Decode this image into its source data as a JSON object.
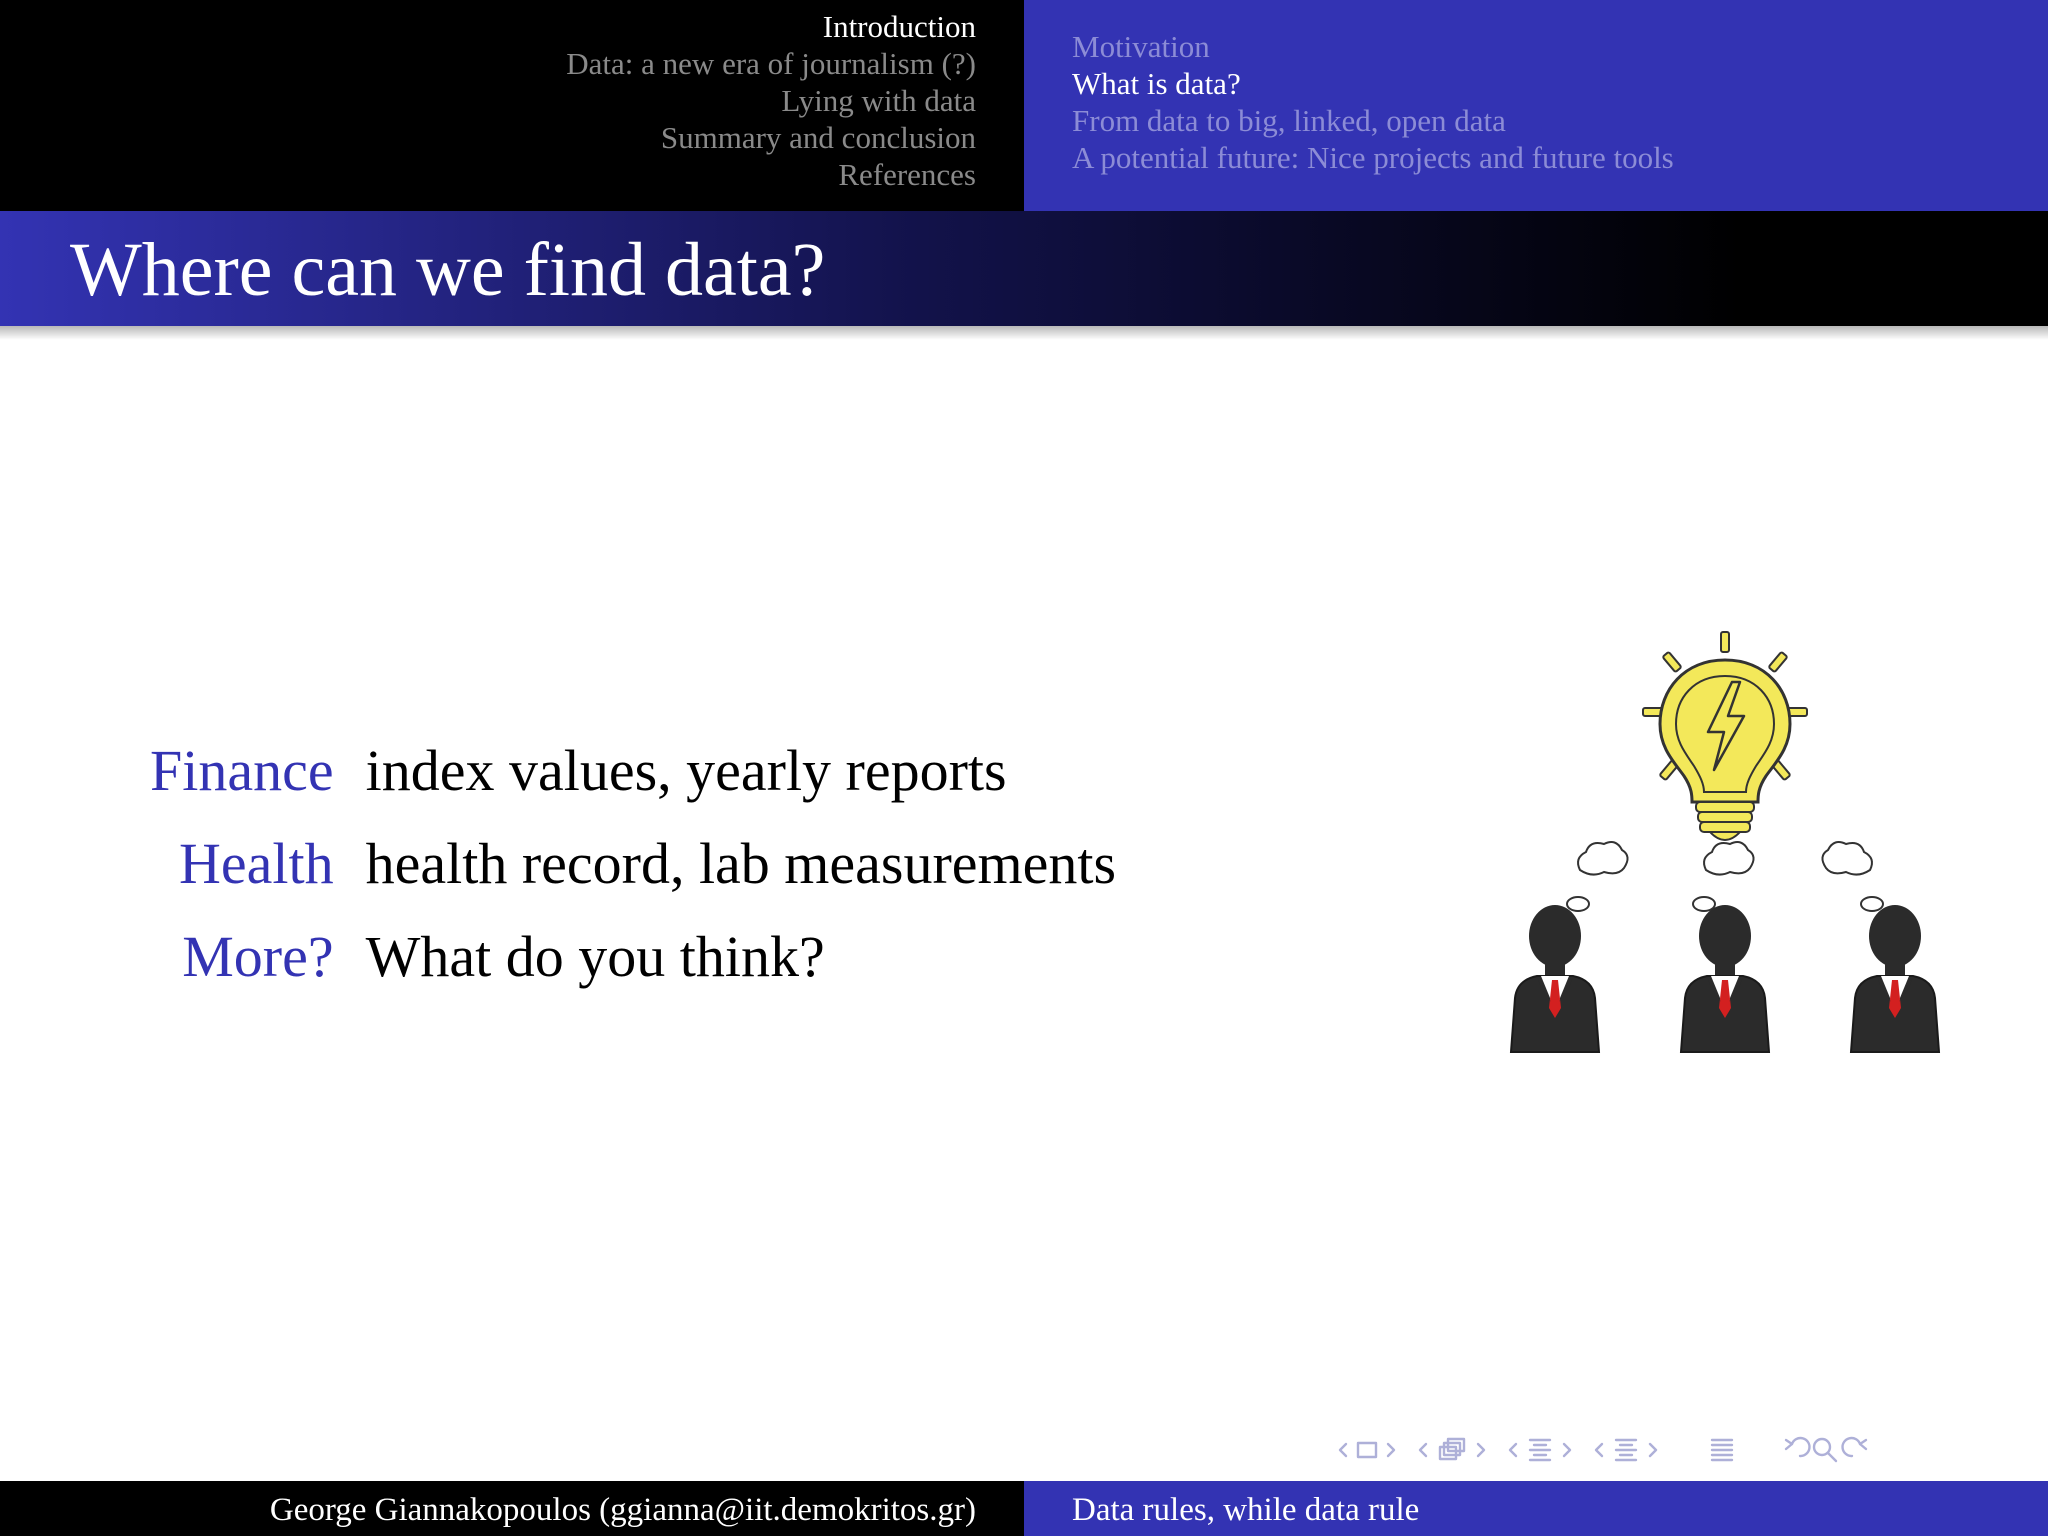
{
  "header": {
    "sections": [
      {
        "label": "Introduction",
        "active": true
      },
      {
        "label": "Data: a new era of  journalism (?)",
        "active": false
      },
      {
        "label": "Lying with data",
        "active": false
      },
      {
        "label": "Summary and conclusion",
        "active": false
      },
      {
        "label": "References",
        "active": false
      }
    ],
    "subsections": [
      {
        "label": "Motivation",
        "active": false
      },
      {
        "label": "What is data?",
        "active": true
      },
      {
        "label": "From data to big, linked, open data",
        "active": false
      },
      {
        "label": "A potential future: Nice projects and future tools",
        "active": false
      }
    ]
  },
  "frame": {
    "title": "Where can we find data?",
    "items": [
      {
        "term": "Finance",
        "definition": "index values, yearly reports"
      },
      {
        "term": "Health",
        "definition": "health record, lab measurements"
      },
      {
        "term": "More?",
        "definition": "What do you think?"
      }
    ]
  },
  "illustration": {
    "icons": [
      "lightbulb-icon",
      "thought-cloud-icon",
      "businessman-icon"
    ]
  },
  "navigation": {
    "icons": [
      "nav-frame-prev-icon",
      "nav-frame-icon",
      "nav-frame-next-icon",
      "nav-subsection-prev-icon",
      "nav-subsection-icon",
      "nav-subsection-next-icon",
      "nav-section-prev-icon",
      "nav-section-icon",
      "nav-section-next-icon",
      "nav-doc-prev-icon",
      "nav-doc-icon",
      "nav-doc-next-icon",
      "nav-toc-icon",
      "nav-back-icon",
      "nav-search-icon",
      "nav-forward-icon"
    ]
  },
  "footer": {
    "author": "George Giannakopoulos  (ggianna@iit.demokritos.gr)",
    "title": "Data rules, while data rule"
  },
  "colors": {
    "structure": "#3333b3",
    "header_dark": "#000000",
    "inactive_section": "#8a8a8a",
    "inactive_subsection": "#8c8cd6"
  }
}
